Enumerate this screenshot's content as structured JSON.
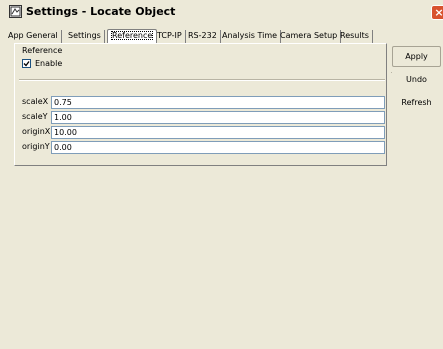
{
  "window": {
    "title": "Settings - Locate Object",
    "close_glyph": "×"
  },
  "tabs": [
    {
      "label": "App General"
    },
    {
      "label": "Settings"
    },
    {
      "label": "Reference",
      "active": true
    },
    {
      "label": "TCP-IP"
    },
    {
      "label": "RS-232"
    },
    {
      "label": "Analysis Time"
    },
    {
      "label": "Camera Setup"
    },
    {
      "label": "Results"
    }
  ],
  "reference": {
    "group_label": "Reference",
    "enable_label": "Enable",
    "enable_checked": true,
    "fields": [
      {
        "label": "scaleX",
        "value": "0.75"
      },
      {
        "label": "scaleY",
        "value": "1.00"
      },
      {
        "label": "originX",
        "value": "10.00"
      },
      {
        "label": "originY",
        "value": "0.00"
      }
    ]
  },
  "actions": {
    "apply_label": "Apply",
    "undo_label": "Undo",
    "refresh_label": "Refresh"
  },
  "colors": {
    "background": "#ece9d8",
    "field_border": "#7f9db9",
    "close_button": "#d8522f"
  },
  "icons": {
    "app": "settings-app-icon",
    "close": "close-icon",
    "check": "checkmark-icon"
  }
}
